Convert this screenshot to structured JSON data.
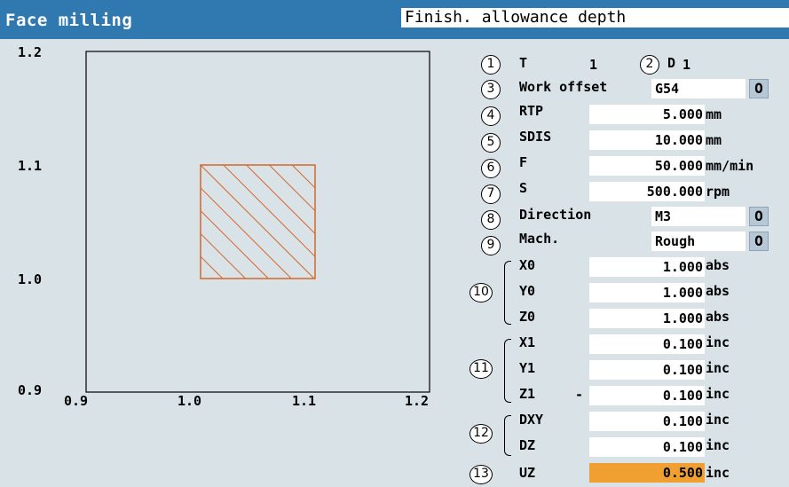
{
  "header": {
    "title": "Face milling",
    "hint": "Finish. allowance depth"
  },
  "chart_data": {
    "type": "line",
    "x_ticks": [
      "0.9",
      "1.0",
      "1.1",
      "1.2"
    ],
    "y_ticks": [
      "1.2",
      "1.1",
      "1.0",
      "0.9"
    ],
    "xlim": [
      0.9,
      1.2
    ],
    "ylim": [
      0.9,
      1.2
    ],
    "workpiece": {
      "x": [
        1.0,
        1.1
      ],
      "y": [
        1.0,
        1.1
      ]
    },
    "colors": {
      "workpiece": "#d4682a",
      "frame": "#000000"
    }
  },
  "params": {
    "t": {
      "num": "1",
      "label": "T",
      "value": "1"
    },
    "d": {
      "num": "2",
      "label": "D",
      "value": "1"
    },
    "work_offset": {
      "num": "3",
      "label": "Work offset",
      "value": "G54"
    },
    "rtp": {
      "num": "4",
      "label": "RTP",
      "value": "5.000",
      "unit": "mm"
    },
    "sdis": {
      "num": "5",
      "label": "SDIS",
      "value": "10.000",
      "unit": "mm"
    },
    "f": {
      "num": "6",
      "label": "F",
      "value": "50.000",
      "unit": "mm/min"
    },
    "s": {
      "num": "7",
      "label": "S",
      "value": "500.000",
      "unit": "rpm"
    },
    "direction": {
      "num": "8",
      "label": "Direction",
      "value": "M3"
    },
    "mach": {
      "num": "9",
      "label": "Mach.",
      "value": "Rough"
    },
    "group10": {
      "num": "10",
      "rows": [
        {
          "label": "X0",
          "value": "1.000",
          "unit": "abs"
        },
        {
          "label": "Y0",
          "value": "1.000",
          "unit": "abs"
        },
        {
          "label": "Z0",
          "value": "1.000",
          "unit": "abs"
        }
      ]
    },
    "group11": {
      "num": "11",
      "rows": [
        {
          "label": "X1",
          "value": "0.100",
          "unit": "inc"
        },
        {
          "label": "Y1",
          "value": "0.100",
          "unit": "inc"
        },
        {
          "label": "Z1",
          "value": "0.100",
          "unit": "inc",
          "sign": "-"
        }
      ]
    },
    "group12": {
      "num": "12",
      "rows": [
        {
          "label": "DXY",
          "value": "0.100",
          "unit": "inc"
        },
        {
          "label": "DZ",
          "value": "0.100",
          "unit": "inc"
        }
      ]
    },
    "uz": {
      "num": "13",
      "label": "UZ",
      "value": "0.500",
      "unit": "inc"
    }
  },
  "icons": {
    "toggle": "cycle-icon"
  },
  "toggle_glyph": "O"
}
